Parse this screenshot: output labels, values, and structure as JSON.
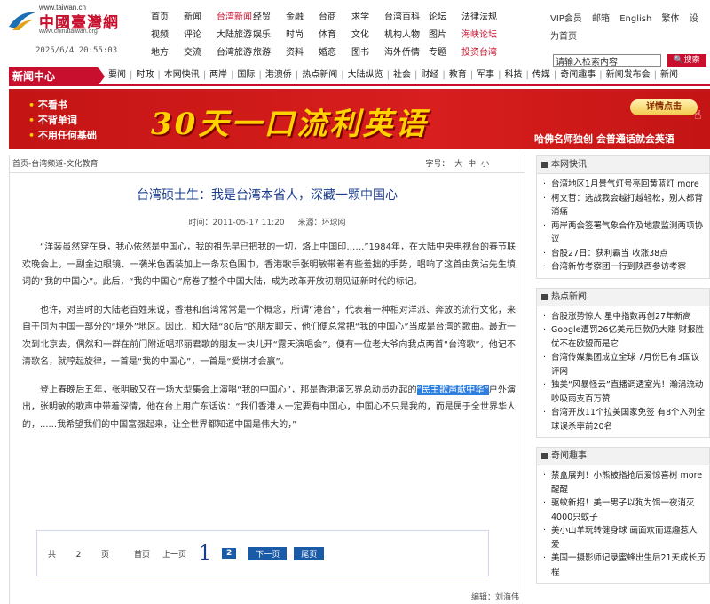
{
  "header": {
    "logo_url": "www.taiwan.cn",
    "logo_name": "中國臺灣網",
    "logo_sub": "www.chinataiwan.org",
    "datetime": "2025/6/4 20:55:03",
    "nav_rows": [
      [
        "首页",
        "新闻",
        "台湾新闻",
        "经贸",
        "金融",
        "台商",
        "求学",
        "台湾百科",
        "论坛",
        "法律法规"
      ],
      [
        "视频",
        "评论",
        "大陆旅游",
        "娱乐",
        "时尚",
        "体育",
        "文化",
        "机构人物",
        "图片",
        "海峡论坛"
      ],
      [
        "地方",
        "交流",
        "台湾旅游",
        "旅游",
        "资料",
        "婚恋",
        "图书",
        "海外侨情",
        "专题",
        "投资台湾"
      ]
    ],
    "top_links": [
      "VIP会员",
      "邮箱",
      "English",
      "繁体",
      "设为首页"
    ],
    "search_placeholder": "请输入检索内容",
    "search_button": "搜索"
  },
  "section": {
    "title": "新闻中心",
    "links": [
      "要闻",
      "时政",
      "本网快讯",
      "两岸",
      "国际",
      "港澳侨",
      "热点新闻",
      "大陆纵览",
      "社会",
      "财经",
      "教育",
      "军事",
      "科技",
      "传媒",
      "奇闻趣事",
      "新闻发布会",
      "新闻"
    ]
  },
  "banner": {
    "bullets": [
      "不看书",
      "不背单词",
      "不用任何基础"
    ],
    "headline": "30天一口流利英语",
    "button": "详情点击",
    "slogan": "哈佛名师独创  会普通话就会英语"
  },
  "article": {
    "breadcrumb": "首页-台湾频道-文化教育",
    "font_size_label": "字号：",
    "font_sizes": [
      "大",
      "中",
      "小"
    ],
    "title": "台湾硕士生：我是台湾本省人，深藏一颗中国心",
    "time": "时间：2011-05-17 11:20",
    "source": "来源：环球网",
    "p1": "“洋装虽然穿在身，我心依然是中国心，我的祖先早已把我的一切，烙上中国印……”1984年，在大陆中央电视台的春节联欢晚会上，一副金边眼镜、一袭米色西装加上一条灰色围巾，香港歌手张明敏带着有些羞拙的手势，唱响了这首由黄沾先生填词的“我的中国心”。此后，“我的中国心”席卷了整个中国大陆，成为改革开放初期见证新时代的标记。",
    "p2": "也许，对当时的大陆老百姓来说，香港和台湾常常是一个概念，所谓“港台”，代表着一种相对洋派、奔放的流行文化，来自于同为中国一部分的“境外”地区。因此，和大陆“80后”的朋友聊天，他们便总常把“我的中国心”当成是台湾的歌曲。最近一次到北京去，偶然和一群在前门附近唱邓丽君歌的朋友一块儿开“露天演唱会”，便有一位老大爷向我点两首“台湾歌”，他记不清歌名，就哼起旋律，一首是“我的中国心”，一首是“爱拼才会赢”。",
    "p3_a": "登上春晚后五年，张明敏又在一场大型集会上演唱“我的中国心”，那是香港演艺界总动员办起的",
    "p3_hl": "“民主歌声献中华”",
    "p3_b": "户外演出，张明敏的歌声中带着深情，他在台上用广东话说：“我们香港人一定要有中国心，中国心不只是我的，而是属于全世界华人的，......我希望我们的中国富强起来，让全世界都知道中国是伟大的，”",
    "pager_total": "共",
    "pager_count": "2",
    "pager_unit": "页",
    "pager_first": "首页",
    "pager_prev": "上一页",
    "pager_current": "1",
    "pager_page2": "2",
    "pager_next": "下一页",
    "pager_last": "尾页",
    "editor": "编辑：刘海伟"
  },
  "sidebar": {
    "boxes": [
      {
        "title": "本网快讯",
        "items": [
          "台湾地区1月景气灯号亮回黄蓝灯 more",
          "柯文哲：选战我会越打越轻松，别人都背消痛",
          "两岸两会签署气象合作及地震监测两项协议",
          "台股27日：获利霸当 收涨38点",
          "台湾新竹考察团一行到陕西参访考察"
        ]
      },
      {
        "title": "热点新闻",
        "items": [
          "台股涨势惊人 星中指数再创27年新高",
          "Google遭罚26亿美元巨款仍大赚 财报胜优不在欧盟而是它",
          "台湾传媒集团成立全球 7月份已有3国议评网",
          "独美“风暴怪云”直播调透室光！瀚涓流动吵吸雨支百万赞",
          "台湾开放11个拉美国家免签 有8个入列全球误杀率前20名"
        ]
      },
      {
        "title": "奇闻趣事",
        "items": [
          "禁盒展判！小熊被指抢后爱惊喜树 more醒醒",
          "驱蚊新招！美一男子以狗为饵一夜消灭4000只蚊子",
          "美小山羊玩转健身球 画面欢而逗趣惹人爱",
          "美国一摄影师记录蜜蜂出生后21天成长历程"
        ]
      }
    ]
  }
}
